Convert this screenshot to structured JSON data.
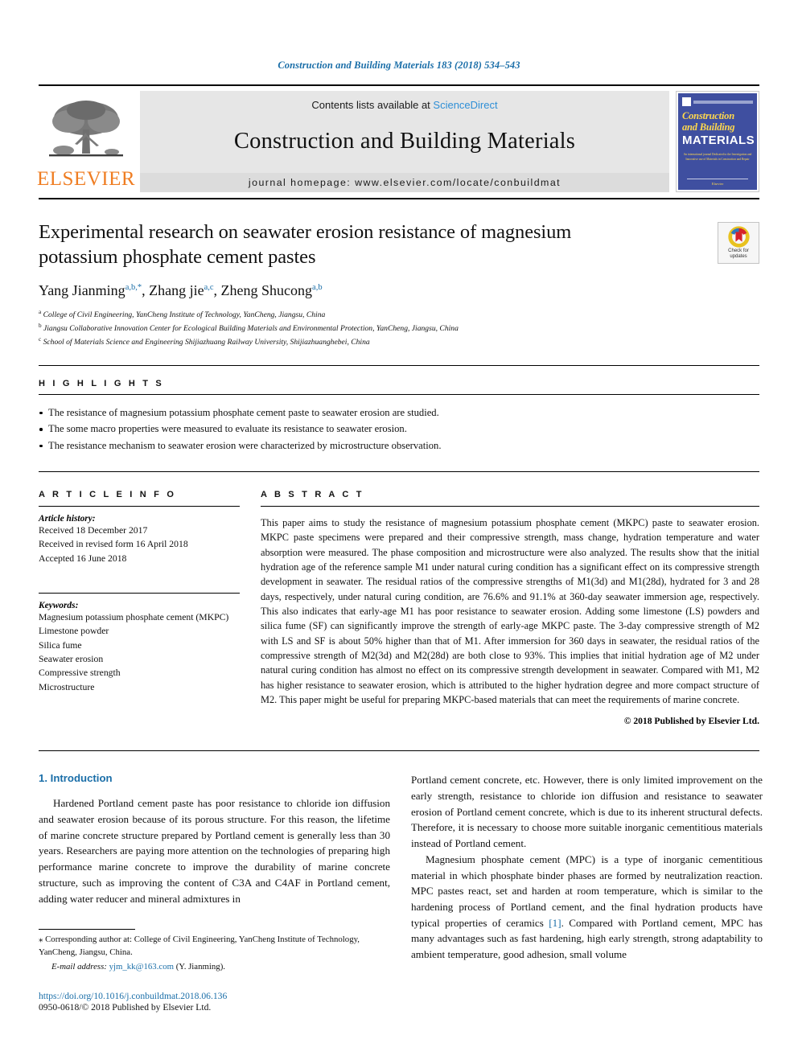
{
  "running_head": "Construction and Building Materials 183 (2018) 534–543",
  "masthead": {
    "publisher_name": "ELSEVIER",
    "contents_prefix": "Contents lists available at ",
    "contents_link": "ScienceDirect",
    "journal_name": "Construction and Building Materials",
    "homepage": "journal homepage: www.elsevier.com/locate/conbuildmat",
    "cover": {
      "title_line1": "Construction",
      "title_line2": "and Building",
      "title_line3": "MATERIALS",
      "blurb": "An international journal Dedicated to the Investigation and Innovative use of Materials in Construction and Repair",
      "foot": "Elsevier"
    }
  },
  "article": {
    "title": "Experimental research on seawater erosion resistance of magnesium potassium phosphate cement pastes",
    "authors": [
      {
        "name": "Yang Jianming",
        "sup": "a,b,*"
      },
      {
        "name": "Zhang jie",
        "sup": "a,c"
      },
      {
        "name": "Zheng Shucong",
        "sup": "a,b"
      }
    ],
    "affiliations": [
      {
        "mark": "a",
        "text": "College of Civil Engineering, YanCheng Institute of Technology, YanCheng, Jiangsu, China"
      },
      {
        "mark": "b",
        "text": "Jiangsu Collaborative Innovation Center for Ecological Building Materials and Environmental Protection, YanCheng, Jiangsu, China"
      },
      {
        "mark": "c",
        "text": "School of Materials Science and Engineering Shijiazhuang Railway University, Shijiazhuanghebei, China"
      }
    ],
    "crossmark_label_line1": "Check for",
    "crossmark_label_line2": "updates"
  },
  "highlights": {
    "heading": "H I G H L I G H T S",
    "items": [
      "The resistance of magnesium potassium phosphate cement paste to seawater erosion are studied.",
      "The some macro properties were measured to evaluate its resistance to seawater erosion.",
      "The resistance mechanism to seawater erosion were characterized by microstructure observation."
    ]
  },
  "article_info": {
    "heading": "A R T I C L E   I N F O",
    "history_label": "Article history:",
    "history": [
      "Received 18 December 2017",
      "Received in revised form 16 April 2018",
      "Accepted 16 June 2018"
    ],
    "keywords_label": "Keywords:",
    "keywords": [
      "Magnesium potassium phosphate cement (MKPC)",
      "Limestone powder",
      "Silica fume",
      "Seawater erosion",
      "Compressive strength",
      "Microstructure"
    ]
  },
  "abstract": {
    "heading": "A B S T R A C T",
    "text": "This paper aims to study the resistance of magnesium potassium phosphate cement (MKPC) paste to seawater erosion. MKPC paste specimens were prepared and their compressive strength, mass change, hydration temperature and water absorption were measured. The phase composition and microstructure were also analyzed. The results show that the initial hydration age of the reference sample M1 under natural curing condition has a significant effect on its compressive strength development in seawater. The residual ratios of the compressive strengths of M1(3d) and M1(28d), hydrated for 3 and 28 days, respectively, under natural curing condition, are 76.6% and 91.1% at 360-day seawater immersion age, respectively. This also indicates that early-age M1 has poor resistance to seawater erosion. Adding some limestone (LS) powders and silica fume (SF) can significantly improve the strength of early-age MKPC paste. The 3-day compressive strength of M2 with LS and SF is about 50% higher than that of M1. After immersion for 360 days in seawater, the residual ratios of the compressive strength of M2(3d) and M2(28d) are both close to 93%. This implies that initial hydration age of M2 under natural curing condition has almost no effect on its compressive strength development in seawater. Compared with M1, M2 has higher resistance to seawater erosion, which is attributed to the higher hydration degree and more compact structure of M2. This paper might be useful for preparing MKPC-based materials that can meet the requirements of marine concrete.",
    "copyright": "© 2018 Published by Elsevier Ltd."
  },
  "body": {
    "section_heading": "1. Introduction",
    "left_paragraph_1": "Hardened Portland cement paste has poor resistance to chloride ion diffusion and seawater erosion because of its porous structure. For this reason, the lifetime of marine concrete structure prepared by Portland cement is generally less than 30 years. Researchers are paying more attention on the technologies of preparing high performance marine concrete to improve the durability of marine concrete structure, such as improving the content of C3A and C4AF in Portland cement, adding water reducer and mineral admixtures in",
    "right_paragraph_1": "Portland cement concrete, etc. However, there is only limited improvement on the early strength, resistance to chloride ion diffusion and resistance to seawater erosion of Portland cement concrete, which is due to its inherent structural defects. Therefore, it is necessary to choose more suitable inorganic cementitious materials instead of Portland cement.",
    "right_paragraph_2_before_ref": "Magnesium phosphate cement (MPC) is a type of inorganic cementitious material in which phosphate binder phases are formed by neutralization reaction. MPC pastes react, set and harden at room temperature, which is similar to the hardening process of Portland cement, and the final hydration products have typical properties of ceramics ",
    "right_paragraph_2_ref": "[1]",
    "right_paragraph_2_after_ref": ". Compared with Portland cement, MPC has many advantages such as fast hardening, high early strength, strong adaptability to ambient temperature, good adhesion, small volume"
  },
  "footer": {
    "corresponding_star": "⁎",
    "corresponding_text": "Corresponding author at: College of Civil Engineering, YanCheng Institute of Technology, YanCheng, Jiangsu, China.",
    "email_label": "E-mail address:",
    "email": "yjm_kk@163.com",
    "email_suffix": "(Y. Jianming).",
    "doi": "https://doi.org/10.1016/j.conbuildmat.2018.06.136",
    "issn_line": "0950-0618/© 2018 Published by Elsevier Ltd."
  },
  "colors": {
    "link_blue": "#1a6ea8",
    "sciencedirect_blue": "#2e8fd6",
    "elsevier_orange": "#ef7d22",
    "cover_blue": "#3f4fa0",
    "cover_yellow": "#ffd84d"
  }
}
